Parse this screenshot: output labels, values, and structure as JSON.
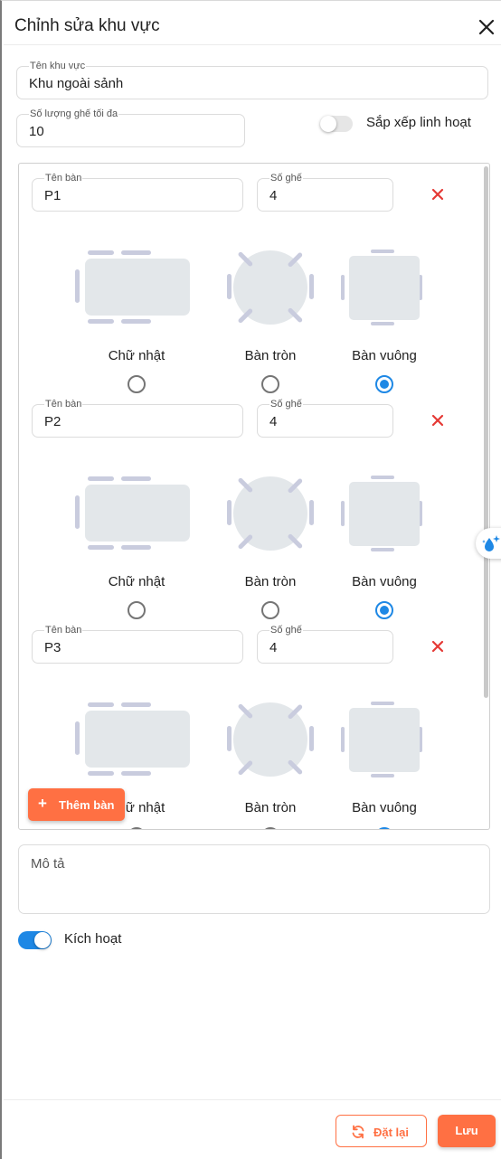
{
  "dialog": {
    "title": "Chỉnh sửa khu vực"
  },
  "area_name": {
    "label": "Tên khu vực",
    "value": "Khu ngoài sảnh"
  },
  "max_seats": {
    "label": "Số lượng ghế tối đa",
    "value": "10"
  },
  "flexible": {
    "label": "Sắp xếp linh hoạt",
    "on": false
  },
  "shape_labels": {
    "rect": "Chữ nhật",
    "round": "Bàn tròn",
    "square": "Bàn vuông"
  },
  "tables": [
    {
      "name_label": "Tên bàn",
      "name": "P1",
      "seats_label": "Số ghế",
      "seats": "4",
      "shape": "square"
    },
    {
      "name_label": "Tên bàn",
      "name": "P2",
      "seats_label": "Số ghế",
      "seats": "4",
      "shape": "square"
    },
    {
      "name_label": "Tên bàn",
      "name": "P3",
      "seats_label": "Số ghế",
      "seats": "4",
      "shape": "square"
    }
  ],
  "add_table": {
    "label": "Thêm bàn",
    "icon": "plus-icon"
  },
  "description": {
    "placeholder": "Mô tả"
  },
  "active": {
    "label": "Kích hoạt",
    "on": true
  },
  "footer": {
    "reset_label": "Đặt lại",
    "save_label": "Lưu"
  },
  "colors": {
    "accent": "#ff7043",
    "primary": "#1e88e5",
    "danger": "#e53935",
    "table_fill": "#e3e7ea",
    "seat": "#c9ccde"
  }
}
